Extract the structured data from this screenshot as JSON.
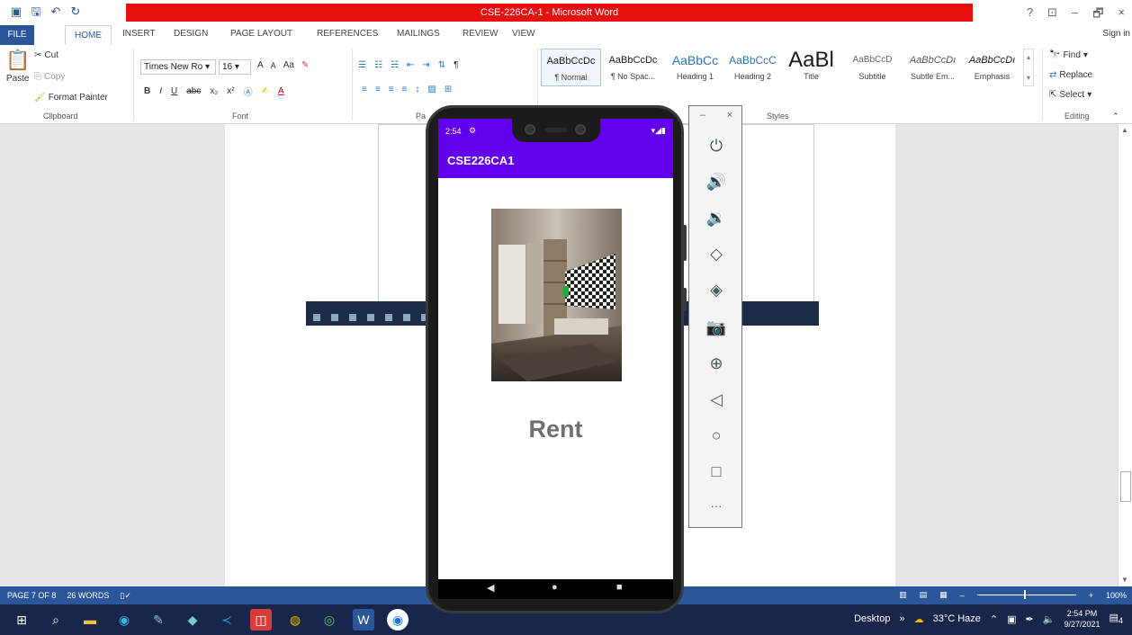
{
  "window": {
    "title": "CSE-226CA-1 - Microsoft Word",
    "help": "?",
    "controls": [
      "⊡",
      "–",
      "🗗",
      "×"
    ]
  },
  "tabs": {
    "file": "FILE",
    "items": [
      "HOME",
      "INSERT",
      "DESIGN",
      "PAGE LAYOUT",
      "REFERENCES",
      "MAILINGS",
      "REVIEW",
      "VIEW"
    ],
    "signin": "Sign in"
  },
  "clipboard": {
    "paste": "Paste",
    "cut": "Cut",
    "copy": "Copy",
    "format_painter": "Format Painter",
    "label": "Clipboard"
  },
  "font": {
    "family": "Times New Ro",
    "size": "16",
    "label": "Font",
    "grow": "A",
    "shrink": "A",
    "case": "Aa",
    "bold": "B",
    "italic": "I",
    "underline": "U",
    "strike": "abc",
    "sub": "x₂",
    "sup": "x²"
  },
  "paragraph": {
    "label": "Pa"
  },
  "styles": {
    "label": "Styles",
    "items": [
      {
        "sample": "AaBbCcDc",
        "name": "¶ Normal"
      },
      {
        "sample": "AaBbCcDc",
        "name": "¶ No Spac..."
      },
      {
        "sample": "AaBbCc",
        "name": "Heading 1"
      },
      {
        "sample": "AaBbCcC",
        "name": "Heading 2"
      },
      {
        "sample": "AaBl",
        "name": "Title"
      },
      {
        "sample": "AaBbCcD",
        "name": "Subtitle"
      },
      {
        "sample": "AaBbCcDı",
        "name": "Subtle Em..."
      },
      {
        "sample": "AaBbCcDı",
        "name": "Emphasis"
      }
    ]
  },
  "editing": {
    "find": "Find",
    "replace": "Replace",
    "select": "Select",
    "label": "Editing"
  },
  "status": {
    "page": "PAGE 7 OF 8",
    "words": "26 WORDS",
    "zoom": "100%"
  },
  "taskbar": {
    "desktop": "Desktop",
    "weather": "33°C Haze",
    "time": "2:54 PM",
    "date": "9/27/2021",
    "notifications": "4"
  },
  "phone": {
    "time": "2:54",
    "app_title": "CSE226CA1",
    "rent_label": "Rent",
    "colors": {
      "primary": "#6200ee"
    }
  },
  "emulator": {
    "minimize": "–",
    "close": "×",
    "more": "···"
  }
}
